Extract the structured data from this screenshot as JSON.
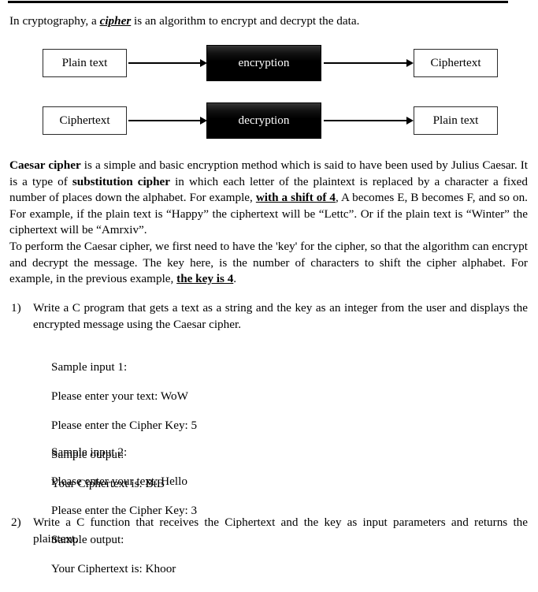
{
  "document": {
    "intro": {
      "before": "In cryptography, a ",
      "emphasis": "cipher",
      "after": " is an algorithm to encrypt and decrypt the data."
    },
    "diagram": {
      "row_encrypt": {
        "input_label": "Plain text",
        "process_label": "encryption",
        "output_label": "Ciphertext"
      },
      "row_decrypt": {
        "input_label": "Ciphertext",
        "process_label": "decryption",
        "output_label": "Plain text"
      }
    },
    "paragraph_caesar": {
      "s1_bold": "Caesar cipher",
      "s2": " is a simple and basic encryption method which is said to have been used by Julius Caesar. It is a type of ",
      "s3_bold": "substitution cipher",
      "s4": " in which each letter of the plaintext is replaced by a character a fixed number of places down the alphabet. For example, ",
      "s5_bold_underline": "with a shift of 4",
      "s6": ", A becomes E, B becomes F, and so on. For example, if the plain text is “Happy” the ciphertext will be “Lettc”. Or if the plain text is “Winter” the ciphertext will be “Amrxiv”."
    },
    "paragraph_key": {
      "s1": "To perform the Caesar cipher, we first need to have the 'key' for the cipher, so that the algorithm can encrypt and decrypt the message. The key here, is the number of characters to shift the cipher alphabet. For example, in the previous example, ",
      "s2_bold_underline": "the key is 4",
      "s3": "."
    },
    "tasks": [
      {
        "marker": "1)",
        "text": "Write a C program that gets a text as a string and the key as an integer from the user and displays the encrypted message using the Caesar cipher."
      },
      {
        "marker": "2)",
        "text": "Write a C function that receives the Ciphertext and the key as input parameters and returns the plaintext."
      }
    ],
    "samples": [
      {
        "heading": "Sample input 1:",
        "prompt_text": "Please enter your text: WoW",
        "prompt_key": "Please enter the Cipher Key: 5",
        "output_heading": "Sample output:",
        "output_value": "Your Ciphertext is: BtB"
      },
      {
        "heading": "Sample input 2:",
        "prompt_text": "Please enter your text: Hello",
        "prompt_key": "Please enter the Cipher Key: 3",
        "output_heading": "Sample output:",
        "output_value": "Your Ciphertext is: Khoor"
      }
    ]
  }
}
